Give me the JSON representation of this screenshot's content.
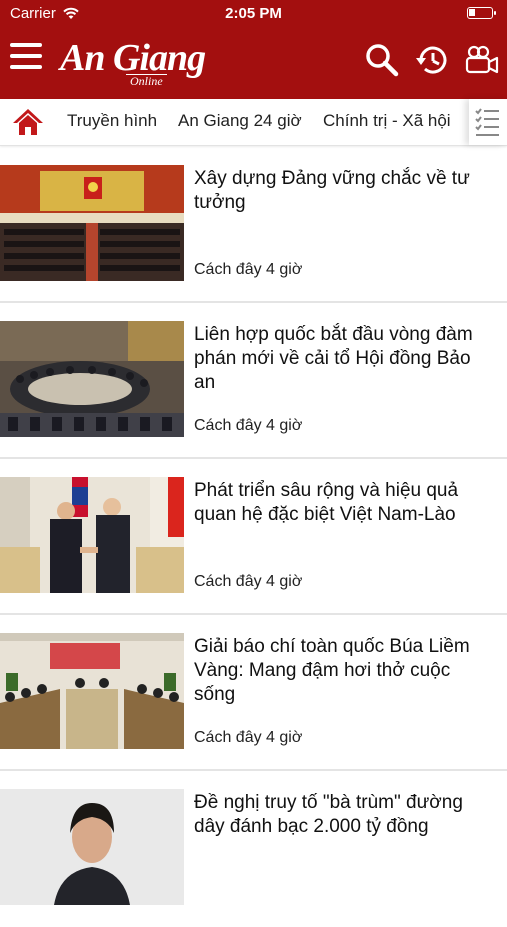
{
  "status_bar": {
    "carrier": "Carrier",
    "time": "2:05 PM"
  },
  "app": {
    "logo_main": "An Giang",
    "logo_sub": "Online",
    "brand_color": "#a30f0f",
    "icons": [
      "menu-icon",
      "search-icon",
      "history-icon",
      "video-camera-icon",
      "home-icon",
      "list-icon"
    ]
  },
  "categories": [
    "Truyền hình",
    "An Giang 24 giờ",
    "Chính trị - Xã hội"
  ],
  "articles": [
    {
      "title": "Xây dựng Đảng vững chắc về tư tưởng",
      "time": "Cách đây 4 giờ"
    },
    {
      "title": "Liên hợp quốc bắt đầu vòng đàm phán mới về cải tổ Hội đồng Bảo an",
      "time": "Cách đây 4 giờ"
    },
    {
      "title": "Phát triển sâu rộng và hiệu quả quan hệ đặc biệt Việt Nam-Lào",
      "time": "Cách đây 4 giờ"
    },
    {
      "title": "Giải báo chí toàn quốc Búa Liềm Vàng: Mang đậm hơi thở cuộc sống",
      "time": "Cách đây 4 giờ"
    },
    {
      "title": "Đề nghị truy tố \"bà trùm\" đường dây đánh bạc 2.000 tỷ đồng",
      "time": ""
    }
  ]
}
